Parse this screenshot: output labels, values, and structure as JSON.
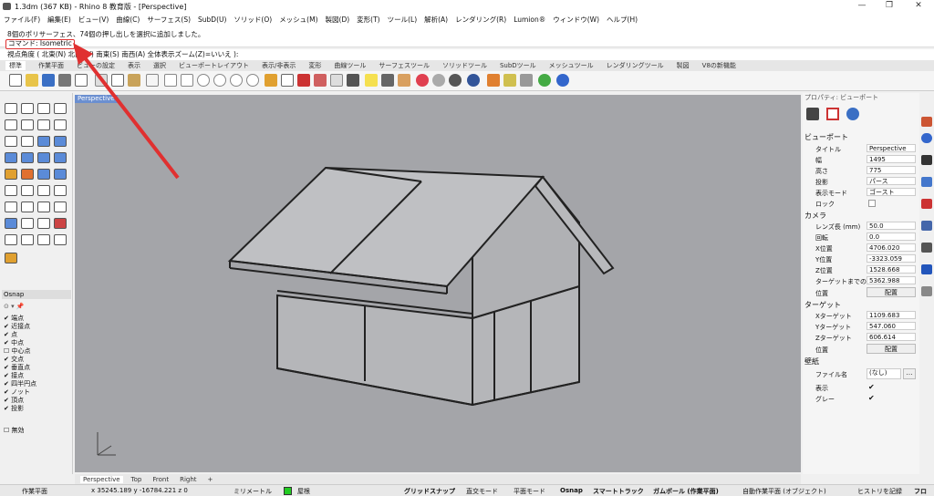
{
  "window": {
    "title": "1.3dm (367 KB) - Rhino 8 教育版 - [Perspective]"
  },
  "menu": [
    "ファイル(F)",
    "編集(E)",
    "ビュー(V)",
    "曲線(C)",
    "サーフェス(S)",
    "SubD(U)",
    "ソリッド(O)",
    "メッシュ(M)",
    "製図(D)",
    "変形(T)",
    "ツール(L)",
    "解析(A)",
    "レンダリング(R)",
    "Lumion®",
    "ウィンドウ(W)",
    "ヘルプ(H)"
  ],
  "command": {
    "history": "8個のポリサーフェス、74個の押し出しを選択に追加しました。",
    "prompt": "コマンド: Isometric",
    "view_angle": "視点角度 ( 北東(N)  北西(W)  南東(S)  南西(A)  全体表示ズーム(Z)=いいえ ):"
  },
  "tabs": [
    "標準",
    "作業平面",
    "ビューの設定",
    "表示",
    "選択",
    "ビューポートレイアウト",
    "表示/非表示",
    "変形",
    "曲線ツール",
    "サーフェスツール",
    "ソリッドツール",
    "SubDツール",
    "メッシュツール",
    "レンダリングツール",
    "製図",
    "V8の新機能"
  ],
  "viewport": {
    "label": "Perspective",
    "bottom_tabs": [
      "Perspective",
      "Top",
      "Front",
      "Right",
      "+"
    ]
  },
  "osnap": {
    "title": "Osnap",
    "items": [
      {
        "label": "端点",
        "checked": true
      },
      {
        "label": "近接点",
        "checked": true
      },
      {
        "label": "点",
        "checked": true
      },
      {
        "label": "中点",
        "checked": true
      },
      {
        "label": "中心点",
        "checked": false
      },
      {
        "label": "交点",
        "checked": true
      },
      {
        "label": "垂直点",
        "checked": true
      },
      {
        "label": "接点",
        "checked": true
      },
      {
        "label": "四半円点",
        "checked": true
      },
      {
        "label": "ノット",
        "checked": true
      },
      {
        "label": "頂点",
        "checked": true
      },
      {
        "label": "投影",
        "checked": true
      }
    ],
    "disable": "無効"
  },
  "properties": {
    "header": "プロパティ: ビューポート",
    "viewport_section": "ビューポート",
    "fields": {
      "title": {
        "label": "タイトル",
        "value": "Perspective"
      },
      "width": {
        "label": "幅",
        "value": "1495"
      },
      "height": {
        "label": "高さ",
        "value": "775"
      },
      "projection": {
        "label": "投影",
        "value": "パース"
      },
      "display_mode": {
        "label": "表示モード",
        "value": "ゴースト"
      },
      "lock": {
        "label": "ロック"
      }
    },
    "camera_section": "カメラ",
    "camera": {
      "lens": {
        "label": "レンズ長 (mm)",
        "value": "50.0"
      },
      "rotation": {
        "label": "回転",
        "value": "0.0"
      },
      "x": {
        "label": "X位置",
        "value": "4706.020"
      },
      "y": {
        "label": "Y位置",
        "value": "-3323.059"
      },
      "z": {
        "label": "Z位置",
        "value": "1528.668"
      },
      "target_dist": {
        "label": "ターゲットまでの",
        "value": "5362.988"
      },
      "pos": {
        "label": "位置",
        "button": "配置"
      }
    },
    "target_section": "ターゲット",
    "target": {
      "x": {
        "label": "Xターゲット",
        "value": "1109.683"
      },
      "y": {
        "label": "Yターゲット",
        "value": "547.060"
      },
      "z": {
        "label": "Zターゲット",
        "value": "606.614"
      },
      "pos": {
        "label": "位置",
        "button": "配置"
      }
    },
    "wallpaper_section": "壁紙",
    "wallpaper": {
      "file": {
        "label": "ファイル名",
        "value": "(なし)"
      },
      "show": {
        "label": "表示"
      },
      "gray": {
        "label": "グレー"
      }
    }
  },
  "status": {
    "cplane": "作業平面",
    "coords": "x 35245.189  y -16784.221  z 0",
    "units": "ミリメートル",
    "layer": "屋根",
    "items": [
      "グリッドスナップ",
      "直交モード",
      "平面モード",
      "Osnap",
      "スマートトラック",
      "ガムボール (作業平面)",
      "自動作業平面 (オブジェクト)",
      "ヒストリを記録",
      "フロ"
    ]
  },
  "colors": {
    "annotation_red": "#e03030",
    "viewport_bg": "#a4a5a9",
    "layer_green": "#22cc22"
  }
}
